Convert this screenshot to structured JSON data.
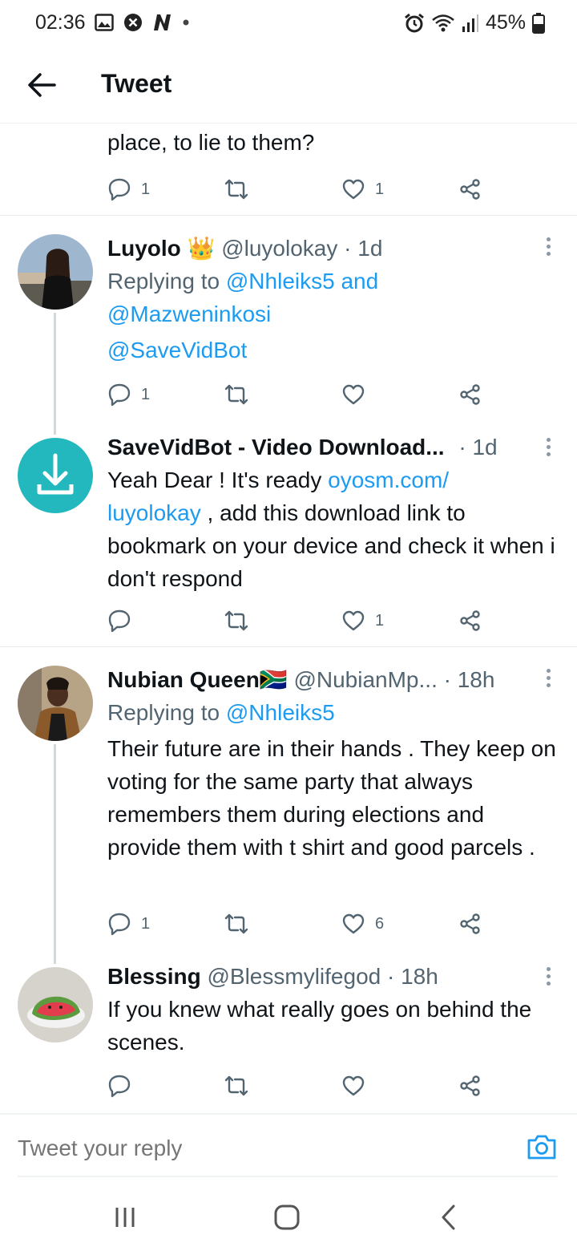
{
  "status_bar": {
    "time": "02:36",
    "battery": "45%"
  },
  "header": {
    "title": "Tweet"
  },
  "tweets": [
    {
      "text": "place, to lie to them?",
      "reply_count": "1",
      "like_count": "1"
    },
    {
      "name": "Luyolo",
      "badge": "👑",
      "handle": "@luyolokay",
      "time": "· 1d",
      "replying_prefix": "Replying to",
      "replying_to_1": "@Nhleiks5",
      "replying_and": "and",
      "replying_to_2": "@Mazweninkosi",
      "text": "@SaveVidBot",
      "reply_count": "1",
      "like_count": ""
    },
    {
      "name": "SaveVidBot - Video Download...",
      "time": "· 1d",
      "text_1": "Yeah Dear ! It's ready ",
      "link_1": "oyosm.com/",
      "link_2": "luyolokay",
      "text_2": " , add this download link to bookmark on your device and check it when i don't respond",
      "reply_count": "",
      "like_count": "1"
    },
    {
      "name": "Nubian Queen",
      "flag": "🇿🇦",
      "handle": "@NubianMp...",
      "time": "· 18h",
      "replying_prefix": "Replying to",
      "replying_to_1": "@Nhleiks5",
      "text": "Their future are in their hands . They keep on voting for the same party that always remembers them during elections and provide them with t shirt and good parcels .",
      "reply_count": "1",
      "like_count": "6"
    },
    {
      "name": "Blessing",
      "handle": "@Blessmylifegod",
      "time": "· 18h",
      "text": "If you knew what really goes on behind the scenes.",
      "reply_count": "",
      "like_count": ""
    }
  ],
  "reply_bar": {
    "placeholder": "Tweet your reply"
  },
  "colors": {
    "accent": "#1d9bf0",
    "muted": "#536471",
    "savevid_avatar": "#22b8bd"
  }
}
